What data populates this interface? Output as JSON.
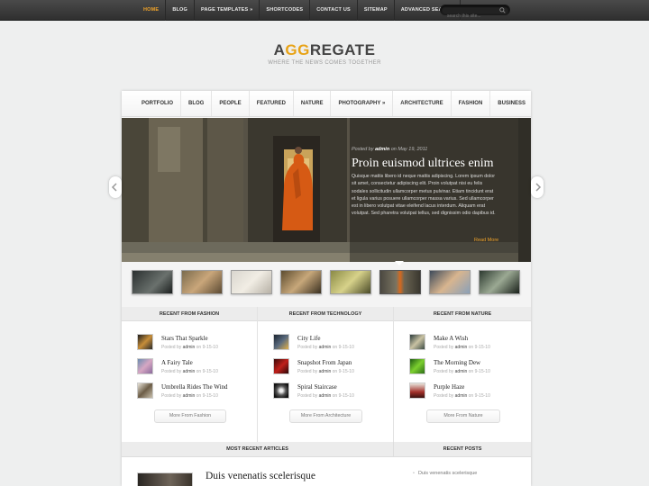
{
  "top_nav": {
    "items": [
      "HOME",
      "BLOG",
      "PAGE TEMPLATES »",
      "SHORTCODES",
      "CONTACT US",
      "SITEMAP",
      "ADVANCED SEARCH"
    ],
    "active": "HOME",
    "search_placeholder": "search this site..."
  },
  "logo": {
    "brand_start": "A",
    "brand_gg": "GG",
    "brand_end": "REGATE",
    "tagline": "WHERE THE NEWS COMES TOGETHER"
  },
  "category_nav": {
    "items": [
      "PORTFOLIO",
      "BLOG",
      "PEOPLE",
      "FEATURED",
      "NATURE",
      "PHOTOGRAPHY »",
      "ARCHITECTURE",
      "FASHION",
      "BUSINESS"
    ]
  },
  "featured": {
    "meta_prefix": "Posted by",
    "author": "admin",
    "date_prefix": "on",
    "date": "May 19, 2011",
    "title": "Proin euismod ultrices enim",
    "excerpt": "Quisque mattis libero id neque mattis adipiscing. Lorem ipsum dolor sit amet, consectetur adipiscing elit. Proin volutpat nisi eu felis sodales sollicitudin ullamcorper metus pulvinar. Etiam tincidunt erat et ligula varius posuere ullamcorper massa varius. Sed ullamcorper est in libero volutpat vitae eleifend lacus interdum. Aliquam erat volutpat. Sed pharetra volutpat tellus, sed dignissim odio dapibus id.",
    "read_more": "Read More"
  },
  "thumbs": {
    "count": 8,
    "active_index": 5
  },
  "columns": [
    {
      "header": "RECENT FROM FASHION",
      "posts": [
        {
          "title": "Stars That Sparkle",
          "author": "admin",
          "date": "9-15-10"
        },
        {
          "title": "A Fairy Tale",
          "author": "admin",
          "date": "9-15-10"
        },
        {
          "title": "Umbrella Rides The Wind",
          "author": "admin",
          "date": "9-15-10"
        }
      ],
      "more": "More From Fashion"
    },
    {
      "header": "RECENT FROM TECHNOLOGY",
      "posts": [
        {
          "title": "City Life",
          "author": "admin",
          "date": "9-15-10"
        },
        {
          "title": "Snapshot From Japan",
          "author": "admin",
          "date": "9-15-10"
        },
        {
          "title": "Spiral Staircase",
          "author": "admin",
          "date": "9-15-10"
        }
      ],
      "more": "More From Architecture"
    },
    {
      "header": "RECENT FROM NATURE",
      "posts": [
        {
          "title": "Make A Wish",
          "author": "admin",
          "date": "9-15-10"
        },
        {
          "title": "The Morning Dew",
          "author": "admin",
          "date": "9-15-10"
        },
        {
          "title": "Purple Haze",
          "author": "admin",
          "date": "9-15-10"
        }
      ],
      "more": "More From Nature"
    }
  ],
  "post_meta": {
    "prefix": "Posted by",
    "on": "on"
  },
  "bottom": {
    "most_recent_header": "MOST RECENT ARTICLES",
    "recent_posts_header": "RECENT POSTS",
    "article_title": "Duis venenatis scelerisque",
    "recent_posts": [
      "Duis venenatis scelerisque"
    ]
  },
  "colors": {
    "accent": "#f0a32a",
    "topbar": "#3a3a3a",
    "page_bg": "#eeefef"
  }
}
